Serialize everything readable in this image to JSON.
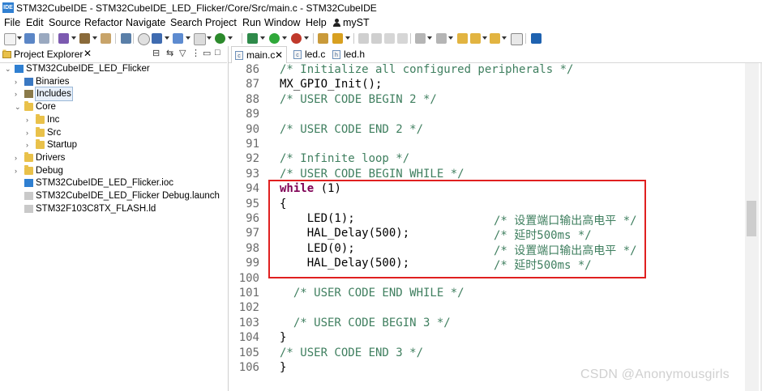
{
  "window": {
    "title": "STM32CubeIDE - STM32CubeIDE_LED_Flicker/Core/Src/main.c - STM32CubeIDE",
    "ide_badge": "IDE"
  },
  "menu": [
    "File",
    "Edit",
    "Source",
    "Refactor",
    "Navigate",
    "Search",
    "Project",
    "Run",
    "Window",
    "Help",
    "myST"
  ],
  "project_explorer": {
    "tab_label": "Project Explorer",
    "tab_close": "✕",
    "tree": [
      {
        "label": "STM32CubeIDE_LED_Flicker",
        "icon": "ide-project-icon",
        "twisty": "expanded",
        "level": 0
      },
      {
        "label": "Binaries",
        "icon": "binaries-icon",
        "twisty": "collapsed",
        "level": 1
      },
      {
        "label": "Includes",
        "icon": "includes-icon",
        "twisty": "collapsed",
        "level": 1,
        "selected": true
      },
      {
        "label": "Core",
        "icon": "folder-icon",
        "twisty": "expanded",
        "level": 1
      },
      {
        "label": "Inc",
        "icon": "folder-icon",
        "twisty": "collapsed",
        "level": 2
      },
      {
        "label": "Src",
        "icon": "folder-icon",
        "twisty": "collapsed",
        "level": 2
      },
      {
        "label": "Startup",
        "icon": "folder-icon",
        "twisty": "collapsed",
        "level": 2
      },
      {
        "label": "Drivers",
        "icon": "folder-icon",
        "twisty": "collapsed",
        "level": 1
      },
      {
        "label": "Debug",
        "icon": "folder-icon",
        "twisty": "collapsed",
        "level": 1
      },
      {
        "label": "STM32CubeIDE_LED_Flicker.ioc",
        "icon": "mx-file-icon",
        "twisty": "none",
        "level": 1
      },
      {
        "label": "STM32CubeIDE_LED_Flicker Debug.launch",
        "icon": "launch-file-icon",
        "twisty": "none",
        "level": 1
      },
      {
        "label": "STM32F103C8TX_FLASH.ld",
        "icon": "ld-file-icon",
        "twisty": "none",
        "level": 1
      }
    ]
  },
  "editor": {
    "tabs": [
      {
        "label": "main.c",
        "close": "✕",
        "active": true
      },
      {
        "label": "led.c",
        "close": "",
        "active": false
      },
      {
        "label": "led.h",
        "close": "",
        "active": false
      }
    ],
    "lines": [
      {
        "num": "86",
        "text": "/* Initialize all configured peripherals */",
        "kind": "comment"
      },
      {
        "num": "87",
        "text": "MX_GPIO_Init();",
        "kind": "code"
      },
      {
        "num": "88",
        "text": "/* USER CODE BEGIN 2 */",
        "kind": "comment"
      },
      {
        "num": "89",
        "text": "",
        "kind": "code"
      },
      {
        "num": "90",
        "text": "/* USER CODE END 2 */",
        "kind": "comment"
      },
      {
        "num": "91",
        "text": "",
        "kind": "code"
      },
      {
        "num": "92",
        "text": "/* Infinite loop */",
        "kind": "comment"
      },
      {
        "num": "93",
        "text": "/* USER CODE BEGIN WHILE */",
        "kind": "comment"
      },
      {
        "num": "94",
        "kw": "while",
        "rest": " (1)",
        "kind": "keyword"
      },
      {
        "num": "95",
        "text": "{",
        "kind": "code"
      },
      {
        "num": "96",
        "code": "    LED(1);",
        "comment": "/* 设置端口输出高电平 */",
        "kind": "mixed"
      },
      {
        "num": "97",
        "code": "    HAL_Delay(500);",
        "comment": "/* 延时500ms */",
        "kind": "mixed"
      },
      {
        "num": "98",
        "code": "    LED(0);",
        "comment": "/* 设置端口输出高电平 */",
        "kind": "mixed"
      },
      {
        "num": "99",
        "code": "    HAL_Delay(500);",
        "comment": "/* 延时500ms */",
        "kind": "mixed"
      },
      {
        "num": "100",
        "text": "",
        "kind": "code"
      },
      {
        "num": "101",
        "text": "  /* USER CODE END WHILE */",
        "kind": "comment"
      },
      {
        "num": "102",
        "text": "",
        "kind": "code"
      },
      {
        "num": "103",
        "text": "  /* USER CODE BEGIN 3 */",
        "kind": "comment"
      },
      {
        "num": "104",
        "text": "}",
        "kind": "code"
      },
      {
        "num": "105",
        "text": "/* USER CODE END 3 */",
        "kind": "comment"
      },
      {
        "num": "106",
        "text": "}",
        "kind": "code"
      }
    ]
  },
  "watermark": "CSDN @Anonymousgirls",
  "colors": {
    "comment": "#3f7f5f",
    "keyword": "#7f0055",
    "line_number": "#6b6b6b",
    "highlight_box": "#e02020"
  }
}
